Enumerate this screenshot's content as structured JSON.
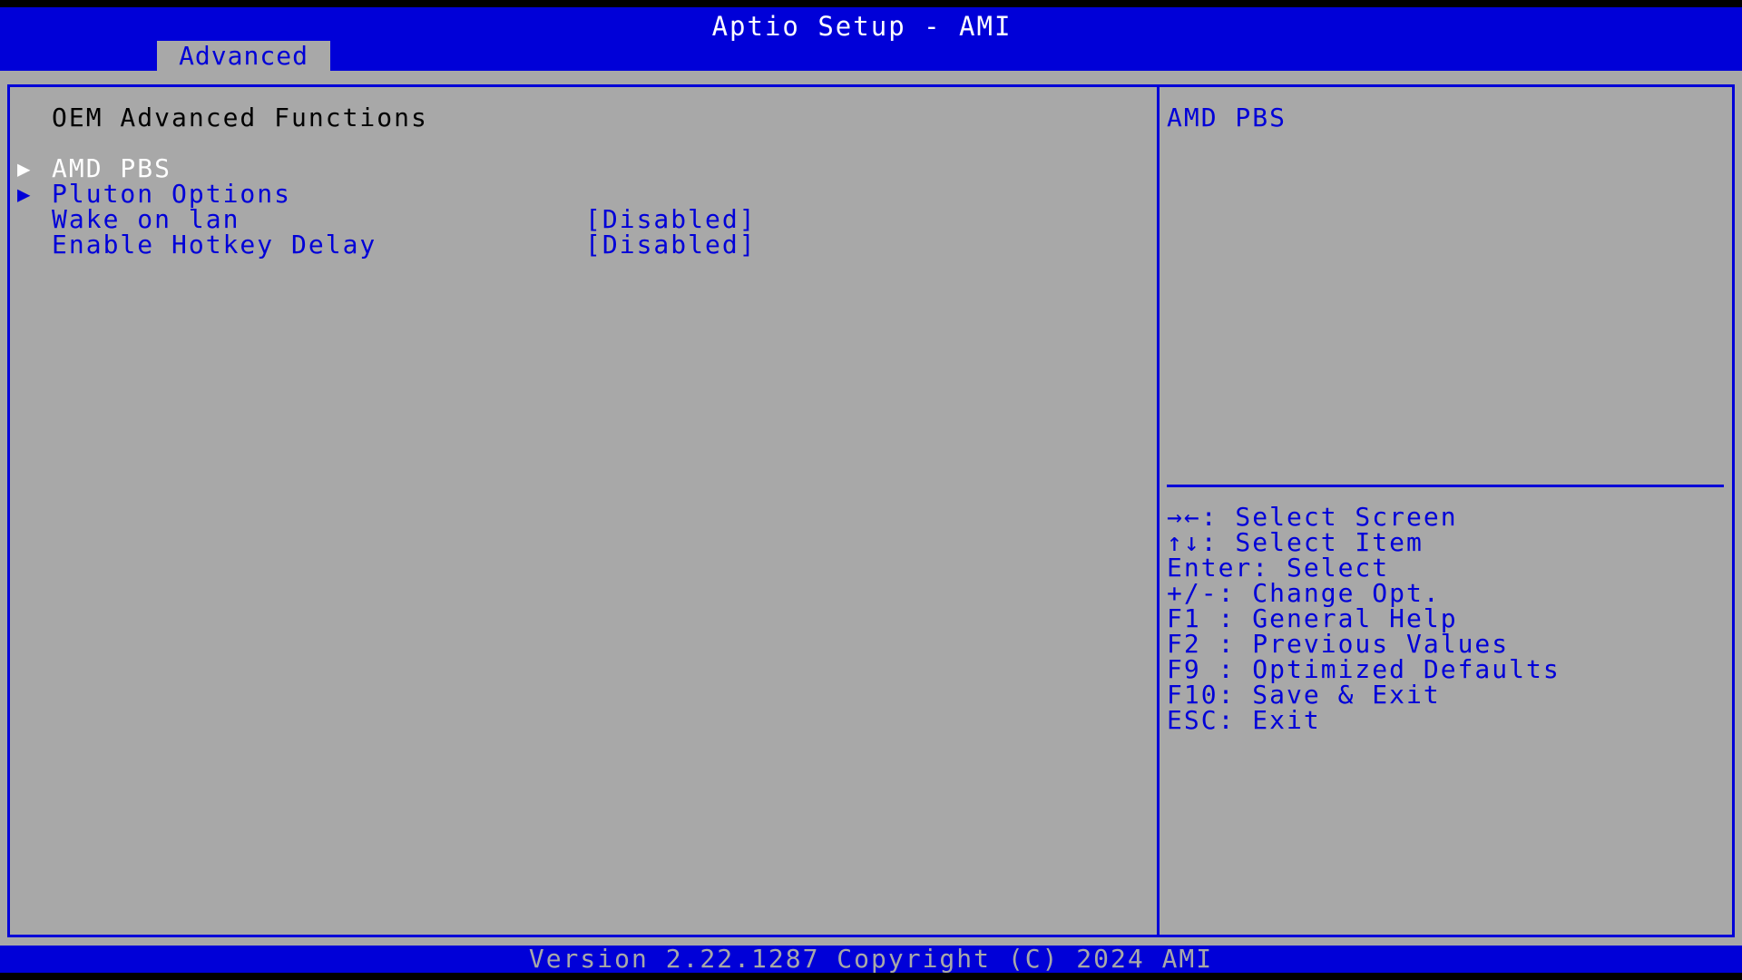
{
  "header": {
    "title": "Aptio Setup - AMI",
    "active_tab": "Advanced"
  },
  "main": {
    "heading": "OEM Advanced Functions",
    "items": [
      {
        "label": "AMD PBS",
        "submenu": true,
        "selected": true
      },
      {
        "label": "Pluton Options",
        "submenu": true,
        "selected": false
      },
      {
        "label": "Wake on lan",
        "value": "[Disabled]"
      },
      {
        "label": "Enable Hotkey Delay",
        "value": "[Disabled]"
      }
    ]
  },
  "help": {
    "description": "AMD PBS",
    "keys": [
      {
        "icon": "left-right-arrows-icon",
        "glyph": "→←",
        "text": ": Select Screen"
      },
      {
        "icon": "up-down-arrows-icon",
        "glyph": "↑↓",
        "text": ": Select Item"
      },
      {
        "text": "Enter: Select"
      },
      {
        "text": "+/-: Change Opt."
      },
      {
        "text": "F1 : General Help"
      },
      {
        "text": "F2 : Previous Values"
      },
      {
        "text": "F9 : Optimized Defaults"
      },
      {
        "text": "F10: Save & Exit"
      },
      {
        "text": "ESC: Exit"
      }
    ]
  },
  "footer": {
    "version": "Version 2.22.1287 Copyright (C) 2024 AMI"
  },
  "colors": {
    "bios_blue": "#0000d8",
    "panel_gray": "#a8a8a8",
    "selected_text": "#ffffff"
  },
  "icons": {
    "submenu_arrow": "▶"
  }
}
